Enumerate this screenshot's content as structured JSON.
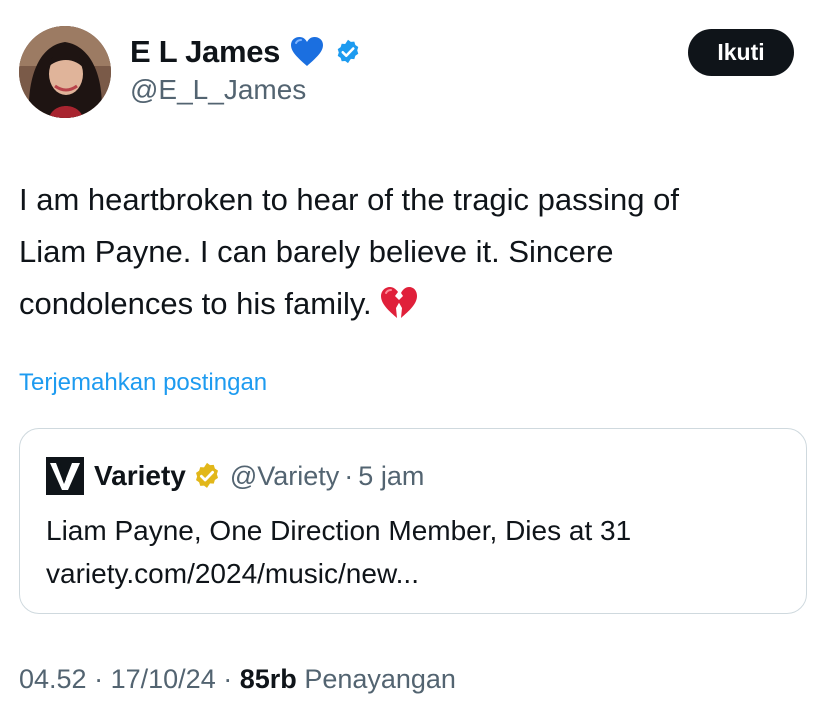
{
  "author": {
    "display_name": "E L James",
    "handle": "@E_L_James",
    "name_emoji": "blue-heart-icon",
    "verified_color": "#1d9bf0"
  },
  "follow_label": "Ikuti",
  "tweet": {
    "lines": [
      "I am heartbroken to hear of the tragic passing of",
      "Liam Payne. I can barely believe it. Sincere",
      "condolences to his family."
    ],
    "emoji": "broken-heart-icon"
  },
  "translate_label": "Terjemahkan postingan",
  "quote": {
    "name": "Variety",
    "handle": "@Variety",
    "separator": "·",
    "time": "5 jam",
    "headline": "Liam Payne, One Direction Member, Dies at 31",
    "link": "variety.com/2024/music/new...",
    "badge_color": "#e2b719"
  },
  "meta": {
    "time": "04.52",
    "sep1": "·",
    "date": "17/10/24",
    "sep2": "·",
    "views_count": "85rb",
    "views_label": "Penayangan"
  },
  "colors": {
    "text": "#0f1419",
    "secondary": "#536471",
    "link": "#1d9bf0",
    "border": "#cfd9de"
  }
}
